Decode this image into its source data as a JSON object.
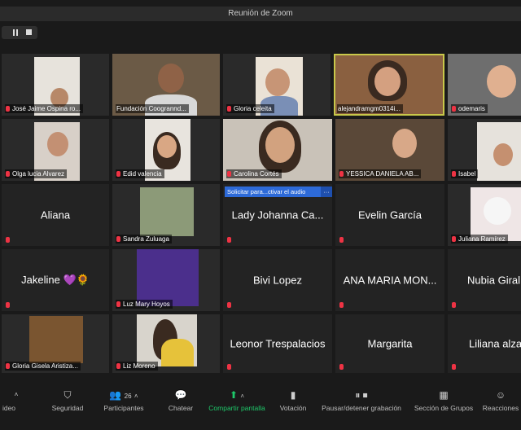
{
  "window": {
    "title": "Reunión de Zoom"
  },
  "banner": {
    "text": "Solicitar para...ctivar el audio",
    "more": "···"
  },
  "participants": [
    {
      "name": "José Jaime Ospina ro..."
    },
    {
      "name": "Fundación Coogrannd..."
    },
    {
      "name": "Gloria celeita"
    },
    {
      "name": "alejandramgm0314i..."
    },
    {
      "name": "odemaris"
    },
    {
      "name": "Olga lucia Alvarez"
    },
    {
      "name": "Edid valencia"
    },
    {
      "name": "Carolina Cortés"
    },
    {
      "name": "YESSICA DANIELA AB..."
    },
    {
      "name": "Isabel"
    },
    {
      "name": "Aliana"
    },
    {
      "name": "Sandra Zuluaga"
    },
    {
      "name": "Lady Johanna Ca..."
    },
    {
      "name": "Evelin García"
    },
    {
      "name": "Juliana Ramírez"
    },
    {
      "name": "Jakeline 💜🌻"
    },
    {
      "name": "Luz Mary Hoyos"
    },
    {
      "name": "Bivi Lopez"
    },
    {
      "name": "ANA MARIA MON..."
    },
    {
      "name": "Nubia Giral"
    },
    {
      "name": "Gloria Gisela Aristiza..."
    },
    {
      "name": "Liz Moreno"
    },
    {
      "name": "Leonor Trespalacios"
    },
    {
      "name": "Margarita"
    },
    {
      "name": "Liliana alza"
    }
  ],
  "toolbar": {
    "video": "ideo",
    "security": "Seguridad",
    "participants": "Participantes",
    "participants_count": "26",
    "chat": "Chatear",
    "share": "Compartir pantalla",
    "poll": "Votación",
    "record": "Pausar/detener grabación",
    "rooms": "Sección de Grupos",
    "reactions": "Reacciones"
  },
  "colors": {
    "accent_green": "#1ec96a",
    "banner_blue": "#2d6ad8",
    "active_speaker": "#c8c84a",
    "mic_muted": "#ee3344"
  }
}
